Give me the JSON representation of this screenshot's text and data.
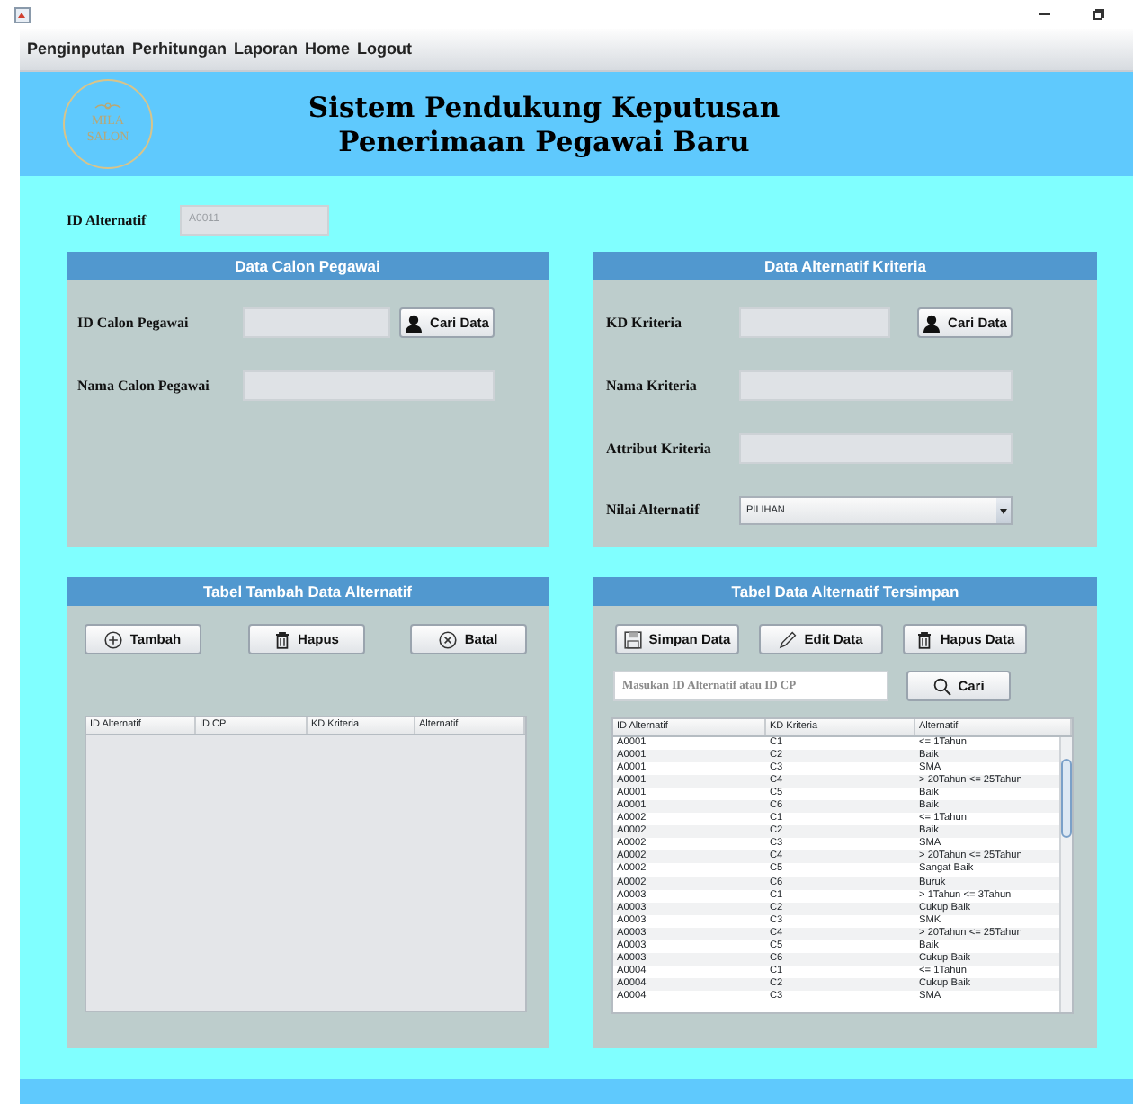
{
  "menu": [
    "Penginputan",
    "Perhitungan",
    "Laporan",
    "Home",
    "Logout"
  ],
  "header": {
    "logo_lines": [
      "MILA",
      "SALON"
    ],
    "title_lines": [
      "Sistem Pendukung Keputusan",
      "Penerimaan Pegawai Baru"
    ]
  },
  "id_alternatif": {
    "label": "ID Alternatif",
    "value": "A0011",
    "disabled": true
  },
  "calon_pegawai": {
    "title": "Data Calon Pegawai",
    "fields": [
      {
        "label": "ID Calon Pegawai",
        "kind": "lookup",
        "button": "Cari Data"
      },
      {
        "label": "Nama Calon Pegawai",
        "kind": "text"
      }
    ]
  },
  "kriteria": {
    "title": "Data Alternatif Kriteria",
    "fields": [
      {
        "label": "KD Kriteria",
        "kind": "lookup",
        "button": "Cari Data"
      },
      {
        "label": "Nama Kriteria",
        "kind": "text"
      },
      {
        "label": "Attribut Kriteria",
        "kind": "text"
      },
      {
        "label": "Nilai Alternatif",
        "kind": "select",
        "value": "PILIHAN"
      }
    ]
  },
  "tambah": {
    "title": "Tabel Tambah Data Alternatif",
    "buttons": [
      {
        "label": "Tambah",
        "kind": "plus"
      },
      {
        "label": "Hapus",
        "kind": "trash"
      },
      {
        "label": "Batal",
        "kind": "cancel"
      }
    ],
    "table": {
      "columns": [
        "ID Alternatif",
        "ID CP",
        "KD Kriteria",
        "Alternatif"
      ]
    }
  },
  "tersimpan": {
    "title": "Tabel Data Alternatif Tersimpan",
    "buttons": [
      {
        "label": "Simpan Data",
        "kind": "save"
      },
      {
        "label": "Edit Data",
        "kind": "pencil"
      },
      {
        "label": "Hapus Data",
        "kind": "trash"
      }
    ],
    "search": {
      "placeholder": "Masukan ID Alternatif atau ID CP",
      "button": "Cari"
    },
    "table": {
      "columns": [
        "ID Alternatif",
        "KD Kriteria",
        "Alternatif"
      ],
      "rows": [
        [
          "A0001",
          "C1",
          "<= 1Tahun"
        ],
        [
          "A0001",
          "C2",
          "Baik"
        ],
        [
          "A0001",
          "C3",
          "SMA"
        ],
        [
          "A0001",
          "C4",
          "> 20Tahun <= 25Tahun"
        ],
        [
          "A0001",
          "C5",
          "Baik"
        ],
        [
          "A0001",
          "C6",
          "Baik"
        ],
        [
          "A0002",
          "C1",
          "<= 1Tahun"
        ],
        [
          "A0002",
          "C2",
          "Baik"
        ],
        [
          "A0002",
          "C3",
          "SMA"
        ],
        [
          "A0002",
          "C4",
          "> 20Tahun <= 25Tahun"
        ],
        [
          "A0002",
          "C5",
          "Sangat Baik"
        ],
        [
          "A0002",
          "C6",
          "Buruk"
        ],
        [
          "A0003",
          "C1",
          "> 1Tahun <= 3Tahun"
        ],
        [
          "A0003",
          "C2",
          "Cukup Baik"
        ],
        [
          "A0003",
          "C3",
          "SMK"
        ],
        [
          "A0003",
          "C4",
          "> 20Tahun <= 25Tahun"
        ],
        [
          "A0003",
          "C5",
          "Baik"
        ],
        [
          "A0003",
          "C6",
          "Cukup Baik"
        ],
        [
          "A0004",
          "C1",
          "<= 1Tahun"
        ],
        [
          "A0004",
          "C2",
          "Cukup Baik"
        ],
        [
          "A0004",
          "C3",
          "SMA"
        ]
      ]
    }
  }
}
